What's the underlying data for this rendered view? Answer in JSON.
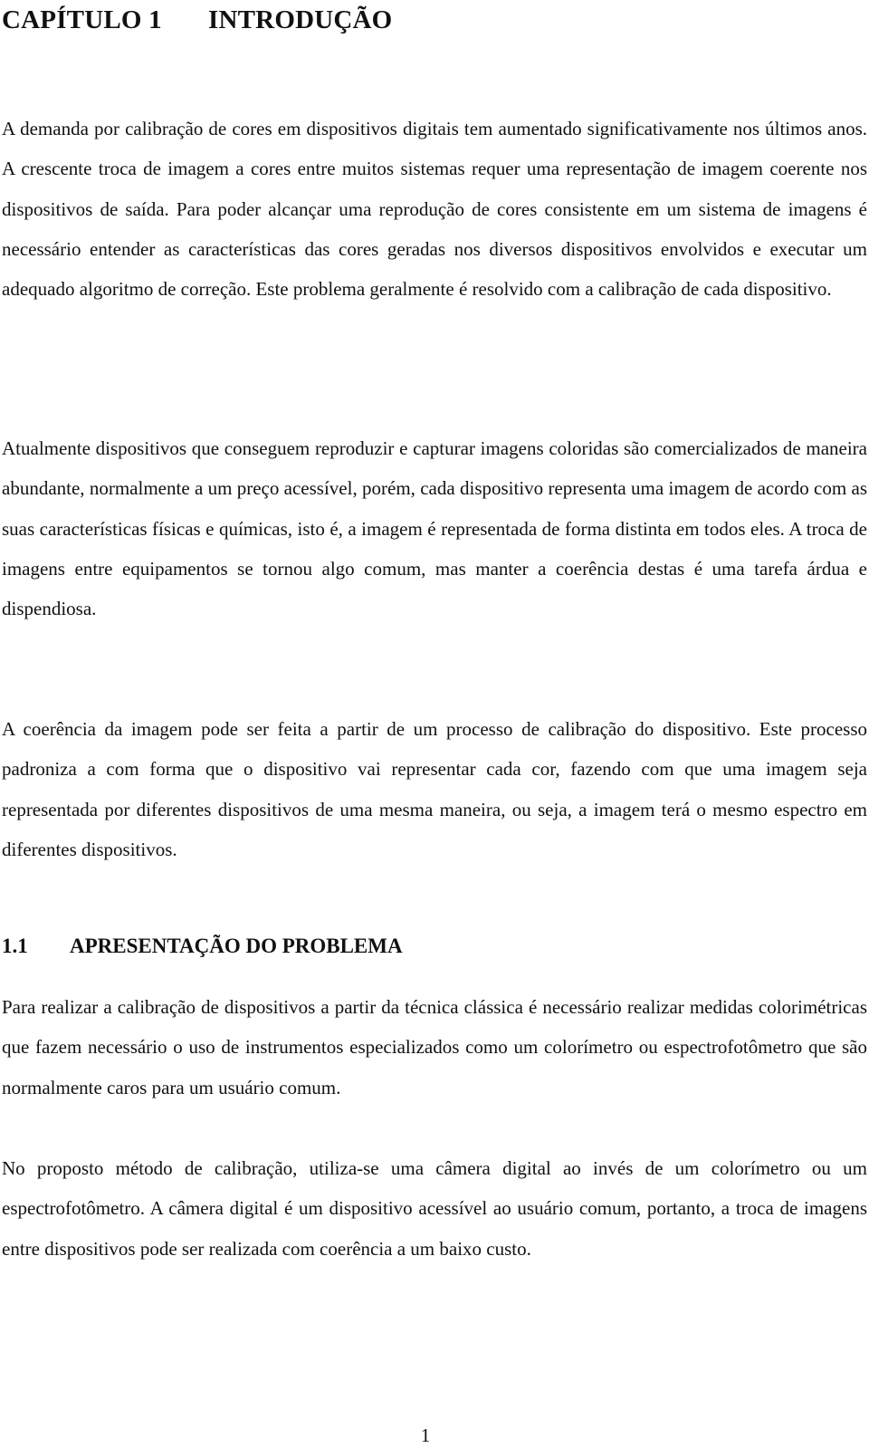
{
  "chapter": {
    "number": "CAPÍTULO 1",
    "title": "INTRODUÇÃO"
  },
  "paragraphs": [
    "A demanda por calibração de cores em dispositivos digitais tem aumentado significativamente nos últimos anos. A crescente troca de imagem a cores entre muitos sistemas requer uma representação de imagem coerente nos dispositivos de saída. Para poder alcançar uma reprodução de cores consistente em um sistema de imagens é necessário entender as características das cores geradas nos diversos dispositivos envolvidos e executar um adequado algoritmo de correção. Este problema geralmente é resolvido com a calibração de cada dispositivo.",
    "Atualmente dispositivos que conseguem reproduzir e capturar imagens coloridas são comercializados de maneira abundante, normalmente a um preço acessível, porém, cada dispositivo representa uma imagem de acordo com as suas características físicas e químicas, isto é, a imagem é representada de forma distinta em todos eles. A troca de imagens entre equipamentos se tornou algo comum, mas manter a coerência destas é uma tarefa árdua e dispendiosa.",
    "A coerência da imagem pode ser feita a partir de um processo de calibração do dispositivo. Este processo padroniza a com forma que o dispositivo vai representar cada cor, fazendo com que uma imagem seja representada por diferentes dispositivos de uma mesma maneira, ou seja, a imagem terá o mesmo espectro em diferentes dispositivos."
  ],
  "section": {
    "number": "1.1",
    "title": "APRESENTAÇÃO DO PROBLEMA",
    "paragraphs": [
      "Para realizar a calibração de dispositivos a partir da técnica clássica é necessário realizar medidas colorimétricas que fazem necessário o uso de instrumentos especializados como um colorímetro ou espectrofotômetro que são normalmente caros para um usuário comum.",
      "No proposto método de calibração, utiliza-se uma câmera digital ao invés de um colorímetro ou um espectrofotômetro. A câmera digital é um dispositivo acessível ao usuário comum, portanto, a troca de imagens entre dispositivos pode ser realizada com coerência a um baixo custo."
    ]
  },
  "page_number": "1"
}
